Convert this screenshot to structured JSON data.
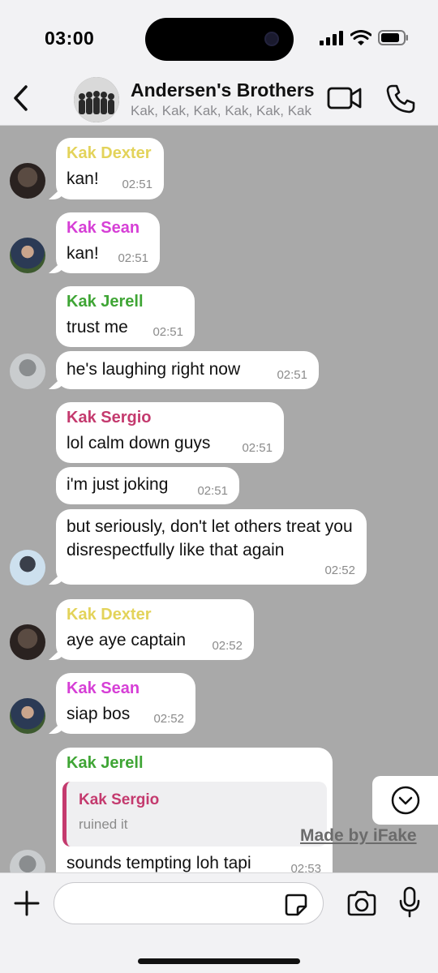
{
  "status_bar": {
    "time": "03:00"
  },
  "header": {
    "title": "Andersen's Brothers",
    "subtitle": "Kak, Kak, Kak, Kak, Kak, Kak"
  },
  "colors": {
    "dexter": "#e3d35a",
    "sean": "#d63fd6",
    "jerell": "#3fa535",
    "sergio": "#c43a6e"
  },
  "messages": [
    {
      "sender": "Kak Dexter",
      "text": "kan!",
      "time": "02:51"
    },
    {
      "sender": "Kak Sean",
      "text": "kan!",
      "time": "02:51"
    },
    {
      "sender": "Kak Jerell",
      "text": "trust me",
      "time": "02:51"
    },
    {
      "sender": "",
      "text": "he's laughing right now",
      "time": "02:51"
    },
    {
      "sender": "Kak Sergio",
      "text": "lol calm down guys",
      "time": "02:51"
    },
    {
      "sender": "",
      "text": "i'm just joking",
      "time": "02:51"
    },
    {
      "sender": "",
      "text": "but seriously, don't let others treat you disrespectfully like that again",
      "time": "02:52"
    },
    {
      "sender": "Kak Dexter",
      "text": "aye aye captain",
      "time": "02:52"
    },
    {
      "sender": "Kak Sean",
      "text": "siap bos",
      "time": "02:52"
    },
    {
      "sender": "Kak Jerell",
      "text": "sounds tempting loh tapi",
      "time": "02:53",
      "reply": {
        "sender": "Kak Sergio",
        "text": "ruined it"
      }
    }
  ],
  "watermark": "Made by iFake",
  "input": {
    "value": "",
    "placeholder": ""
  },
  "icons": [
    "back-chevron-icon",
    "video-camera-icon",
    "phone-icon",
    "chevron-down-circle-icon",
    "plus-icon",
    "sticker-icon",
    "camera-icon",
    "microphone-icon"
  ]
}
